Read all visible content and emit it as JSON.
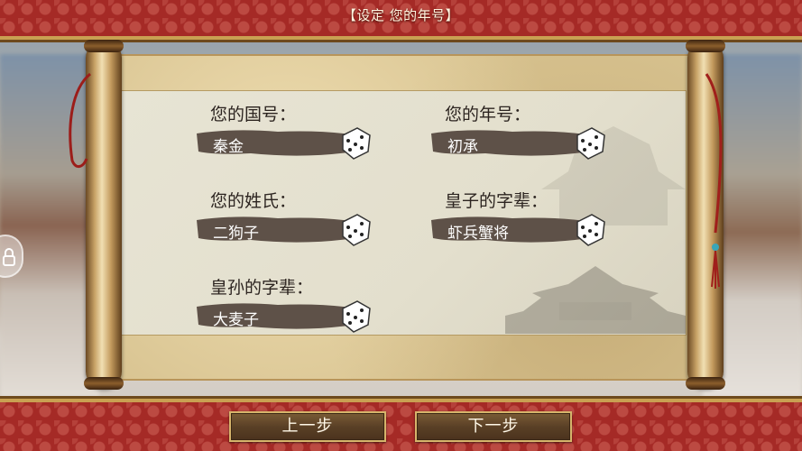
{
  "header": {
    "title": "【设定 您的年号】"
  },
  "form": {
    "fields": [
      {
        "label": "您的国号：",
        "value": "秦金"
      },
      {
        "label": "您的年号：",
        "value": "初承"
      },
      {
        "label": "您的姓氏：",
        "value": "二狗子"
      },
      {
        "label": "皇子的字辈：",
        "value": "虾兵蟹将"
      },
      {
        "label": "皇孙的字辈：",
        "value": "大麦子"
      }
    ]
  },
  "footer": {
    "prev_label": "上一步",
    "next_label": "下一步"
  },
  "colors": {
    "frame_red": "#a52a26",
    "gold_trim": "#c9a052",
    "brush_stroke": "#5e5148"
  },
  "icons": [
    "dice-icon",
    "lock-icon"
  ]
}
